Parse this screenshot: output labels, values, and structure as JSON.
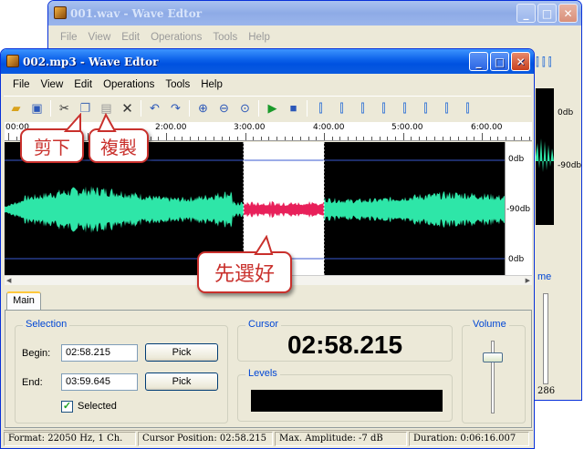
{
  "colors": {
    "wave": "#2ee6a8",
    "selected_wave": "#e8205a",
    "callout": "#c9302c",
    "title_blue": "#0a5fe8"
  },
  "back_window": {
    "title": "001.wav - Wave Edtor",
    "menu": [
      "File",
      "View",
      "Edit",
      "Operations",
      "Tools",
      "Help"
    ],
    "db_labels": [
      "0db",
      "-90db"
    ],
    "volume_label": "me",
    "status_fragment": "286"
  },
  "front_window": {
    "title": "002.mp3 - Wave Edtor",
    "buttons": {
      "minimize": "_",
      "maximize": "□",
      "close": "✕"
    },
    "menu": [
      "File",
      "View",
      "Edit",
      "Operations",
      "Tools",
      "Help"
    ],
    "toolbar_icons": [
      "open-folder-icon",
      "save-icon",
      "cut-icon",
      "copy-icon",
      "paste-icon",
      "delete-icon",
      "undo-icon",
      "redo-icon",
      "zoom-in-icon",
      "zoom-out-icon",
      "zoom-fit-icon",
      "play-icon",
      "stop-icon",
      "wave-tool-1-icon",
      "wave-tool-2-icon",
      "wave-tool-3-icon",
      "wave-tool-4-icon",
      "wave-tool-5-icon",
      "wave-tool-6-icon",
      "wave-tool-7-icon",
      "wave-tool-8-icon"
    ],
    "ruler_labels": [
      "00:00",
      "2:00.00",
      "3:00.00",
      "4:00.00",
      "5:00.00",
      "6:00.00"
    ],
    "db_labels": {
      "top": "0db",
      "mid": "-90db",
      "bottom": "0db"
    },
    "tab": "Main",
    "selection": {
      "title": "Selection",
      "begin_label": "Begin:",
      "begin_value": "02:58.215",
      "end_label": "End:",
      "end_value": "03:59.645",
      "pick_label": "Pick",
      "checkbox_label": "Selected",
      "checked": true
    },
    "cursor": {
      "title": "Cursor",
      "value": "02:58.215"
    },
    "levels": {
      "title": "Levels"
    },
    "volume": {
      "title": "Volume"
    },
    "status": {
      "format": "Format: 22050 Hz, 1 Ch.",
      "cursor_position": "Cursor Position: 02:58.215",
      "max_amplitude": "Max. Amplitude: -7 dB",
      "duration": "Duration: 0:06:16.007"
    }
  },
  "callouts": {
    "cut": "剪下",
    "copy": "複製",
    "select": "先選好"
  }
}
